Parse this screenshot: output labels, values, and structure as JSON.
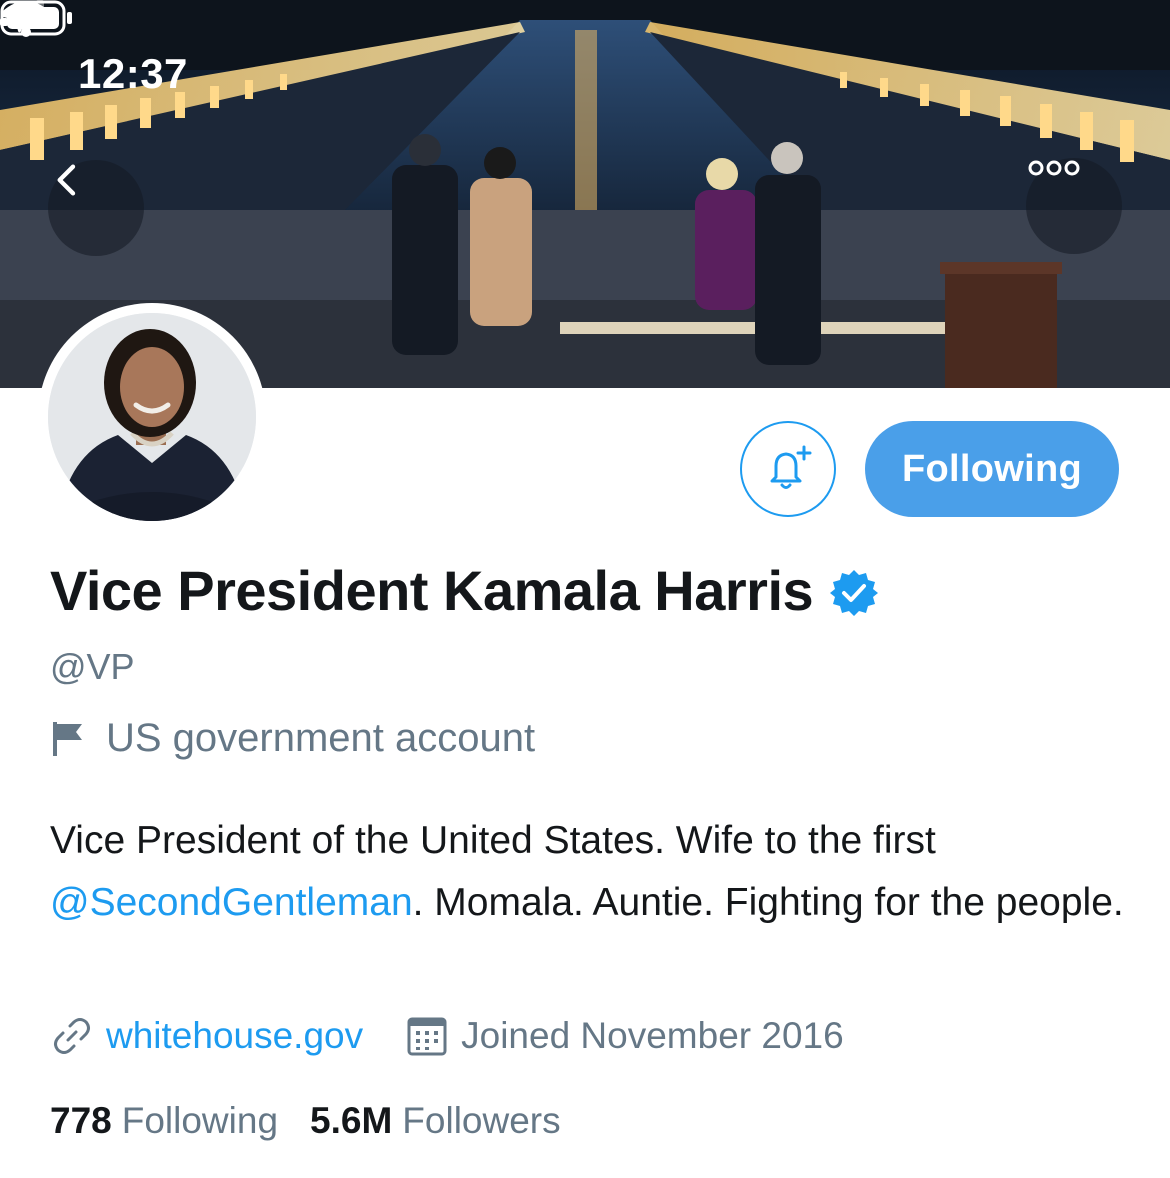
{
  "status_bar": {
    "time": "12:37",
    "icons": [
      "location-arrow-icon",
      "cellular-signal-icon",
      "wifi-icon",
      "battery-icon"
    ]
  },
  "header": {
    "back_icon": "chevron-left-icon",
    "more_icon": "more-horizontal-icon"
  },
  "profile": {
    "display_name": "Vice President Kamala Harris",
    "verified": true,
    "handle": "@VP",
    "account_label": "US government account",
    "bio_part1": "Vice President of the United States. Wife to the first ",
    "bio_mention": "@SecondGentleman",
    "bio_part2": ". Momala. Auntie. Fighting for the people.",
    "website": "whitehouse.gov",
    "joined": "Joined November 2016",
    "following_count": "778",
    "following_label": "Following",
    "followers_count": "5.6M",
    "followers_label": "Followers"
  },
  "actions": {
    "notify_icon": "bell-plus-icon",
    "follow_label": "Following"
  },
  "colors": {
    "accent": "#1d9bf0",
    "follow_button": "#4a9fe9",
    "secondary_text": "#657786",
    "primary_text": "#14171a"
  }
}
